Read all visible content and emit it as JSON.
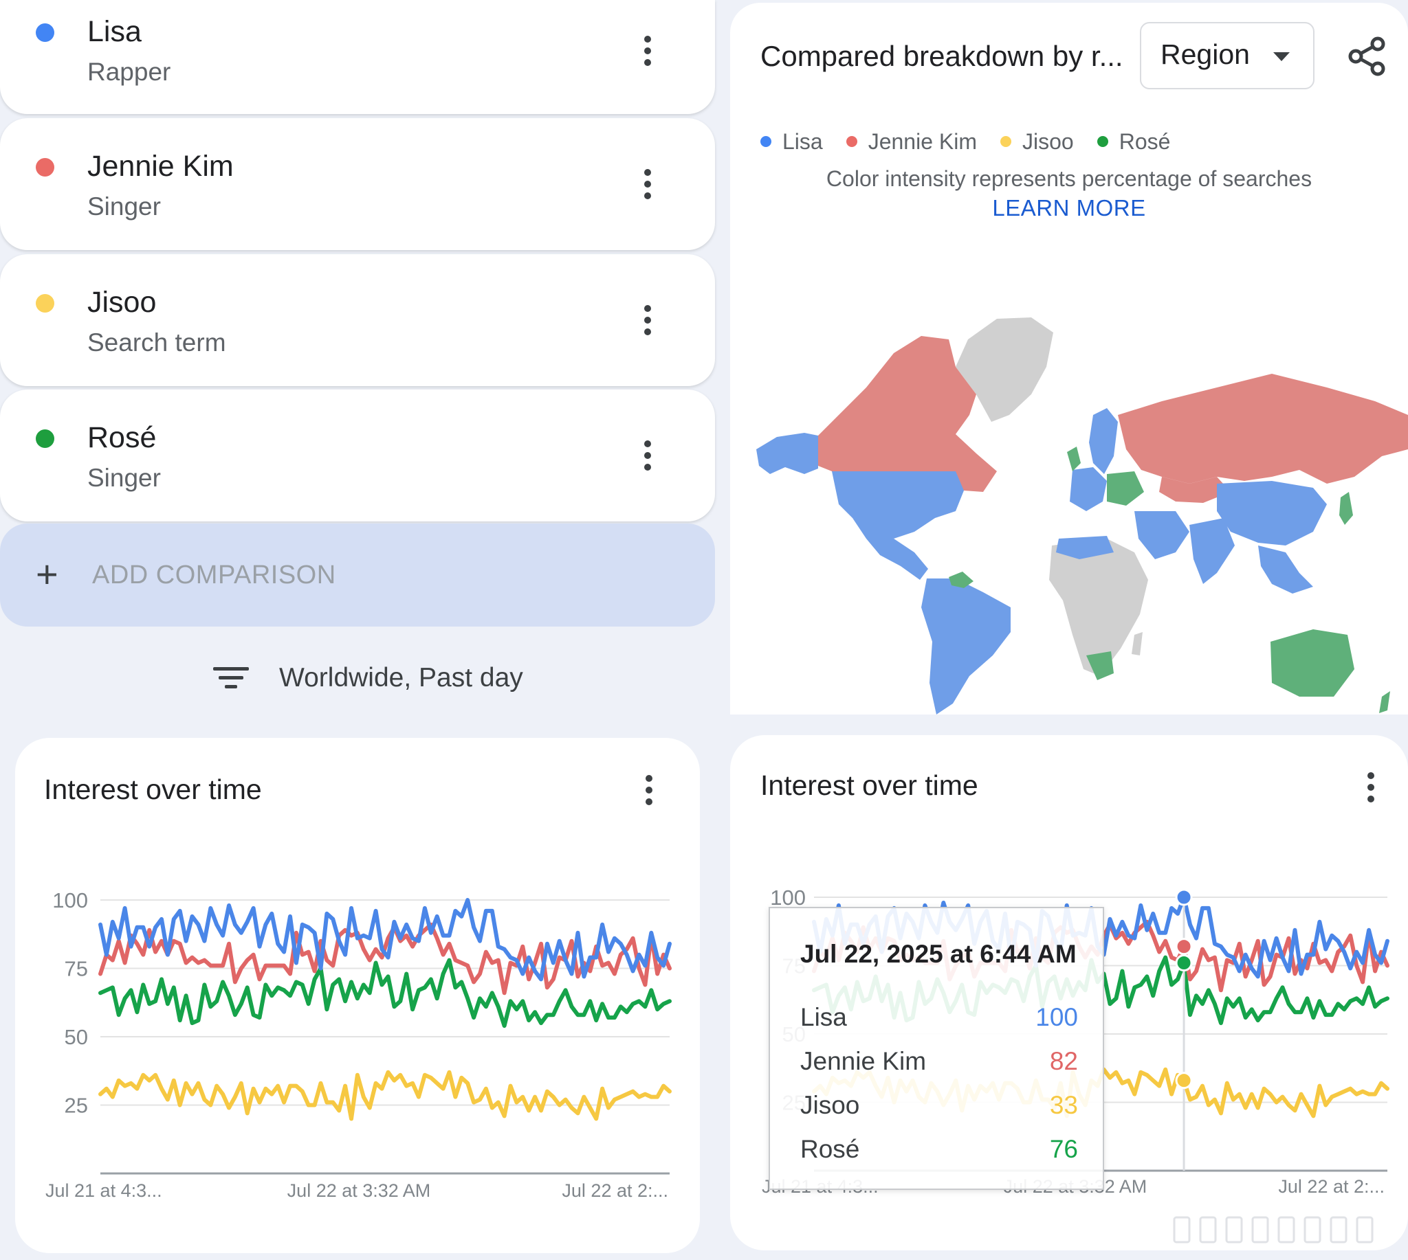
{
  "terms": [
    {
      "name": "Lisa",
      "subtitle": "Rapper",
      "color": "#4285f4"
    },
    {
      "name": "Jennie Kim",
      "subtitle": "Singer",
      "color": "#ea6b66"
    },
    {
      "name": "Jisoo",
      "subtitle": "Search term",
      "color": "#fbd25a"
    },
    {
      "name": "Rosé",
      "subtitle": "Singer",
      "color": "#1e9e3e"
    }
  ],
  "add_comparison": {
    "label": "ADD COMPARISON"
  },
  "filter": {
    "label": "Worldwide, Past day"
  },
  "map_card": {
    "title": "Compared breakdown by r...",
    "region_select": "Region",
    "legend": [
      "Lisa",
      "Jennie Kim",
      "Jisoo",
      "Rosé"
    ],
    "note": "Color intensity represents percentage of searches",
    "learn_more": "LEARN MORE",
    "colors": {
      "lisa": "#6f9ee8",
      "jennie": "#df8783",
      "rose": "#5fb07a",
      "none": "#d0d0d0"
    }
  },
  "interest_left": {
    "title": "Interest over time"
  },
  "interest_right": {
    "title": "Interest over time"
  },
  "tooltip": {
    "date": "Jul 22, 2025 at 6:44 AM",
    "rows": [
      {
        "name": "Lisa",
        "value": "100"
      },
      {
        "name": "Jennie Kim",
        "value": "82"
      },
      {
        "name": "Jisoo",
        "value": "33"
      },
      {
        "name": "Rosé",
        "value": "76"
      }
    ]
  },
  "chart_data": [
    {
      "type": "line",
      "title": "Interest over time",
      "ylim": [
        0,
        100
      ],
      "yticks": [
        "100",
        "75",
        "50",
        "25"
      ],
      "xticks": [
        "Jul 21 at 4:3...",
        "Jul 22 at 3:32 AM",
        "Jul 22 at 2:..."
      ],
      "grid": true,
      "series": [
        {
          "name": "Lisa",
          "color": "#4a86e8",
          "values": [
            91,
            80,
            92,
            86,
            97,
            83,
            90,
            90,
            83,
            90,
            93,
            80,
            93,
            96,
            85,
            94,
            91,
            85,
            97,
            91,
            87,
            98,
            91,
            88,
            92,
            97,
            83,
            91,
            95,
            84,
            81,
            94,
            77,
            91,
            90,
            88,
            75,
            95,
            93,
            85,
            80,
            97,
            86,
            87,
            86,
            96,
            82,
            79,
            92,
            86,
            91,
            86,
            85,
            97,
            88,
            94,
            87,
            87,
            96,
            94,
            100,
            90,
            85,
            96,
            96,
            83,
            82,
            79,
            78,
            73,
            79,
            74,
            71,
            84,
            77,
            85,
            78,
            73,
            88,
            72,
            79,
            79,
            91,
            81,
            86,
            84,
            80,
            74,
            80,
            76,
            88,
            79,
            76,
            84
          ]
        },
        {
          "name": "Jennie Kim",
          "color": "#e06666",
          "values": [
            73,
            80,
            78,
            85,
            77,
            87,
            84,
            80,
            89,
            81,
            85,
            80,
            85,
            84,
            77,
            79,
            77,
            78,
            76,
            76,
            76,
            84,
            70,
            75,
            78,
            80,
            71,
            76,
            76,
            76,
            76,
            73,
            88,
            80,
            81,
            74,
            85,
            78,
            76,
            87,
            89,
            87,
            88,
            82,
            78,
            82,
            79,
            86,
            90,
            85,
            87,
            83,
            87,
            89,
            91,
            86,
            80,
            84,
            78,
            77,
            76,
            70,
            73,
            81,
            77,
            78,
            66,
            77,
            76,
            83,
            71,
            77,
            84,
            68,
            71,
            79,
            78,
            85,
            72,
            77,
            74,
            83,
            76,
            77,
            73,
            80,
            82,
            86,
            75,
            69,
            87,
            73,
            80,
            75
          ]
        },
        {
          "name": "Jisoo",
          "color": "#f6c842",
          "values": [
            29,
            31,
            28,
            34,
            32,
            33,
            31,
            36,
            34,
            36,
            31,
            27,
            34,
            25,
            33,
            29,
            33,
            27,
            25,
            32,
            29,
            24,
            28,
            33,
            22,
            31,
            26,
            31,
            29,
            32,
            26,
            32,
            32,
            30,
            25,
            25,
            33,
            26,
            26,
            23,
            32,
            20,
            36,
            28,
            24,
            33,
            31,
            37,
            34,
            36,
            32,
            33,
            28,
            36,
            35,
            33,
            31,
            37,
            28,
            35,
            33,
            26,
            27,
            31,
            24,
            26,
            21,
            32,
            26,
            28,
            23,
            28,
            23,
            30,
            28,
            25,
            27,
            24,
            22,
            28,
            24,
            20,
            31,
            24,
            27,
            28,
            29,
            30,
            28,
            29,
            28,
            28,
            32,
            30
          ]
        },
        {
          "name": "Rosé",
          "color": "#16a34a",
          "values": [
            66,
            67,
            68,
            58,
            64,
            67,
            59,
            69,
            62,
            63,
            71,
            62,
            68,
            56,
            65,
            55,
            56,
            69,
            61,
            63,
            70,
            65,
            58,
            62,
            68,
            58,
            57,
            69,
            65,
            68,
            67,
            65,
            70,
            69,
            62,
            71,
            75,
            60,
            69,
            71,
            63,
            70,
            64,
            69,
            66,
            77,
            69,
            72,
            61,
            63,
            73,
            60,
            67,
            68,
            71,
            64,
            73,
            78,
            68,
            70,
            64,
            57,
            64,
            61,
            66,
            61,
            54,
            63,
            60,
            63,
            56,
            59,
            55,
            58,
            58,
            63,
            67,
            61,
            58,
            58,
            63,
            56,
            62,
            57,
            57,
            61,
            59,
            62,
            63,
            61,
            67,
            60,
            62,
            63
          ]
        }
      ]
    },
    {
      "type": "line",
      "title": "Interest over time",
      "ylim": [
        0,
        100
      ],
      "yticks": [
        "100",
        "75",
        "50",
        "25"
      ],
      "xticks": [
        "Jul 21 at 4:3...",
        "Jul 22 at 3:32 AM",
        "Jul 22 at 2:..."
      ],
      "grid": true,
      "highlight_index": 60,
      "series": [
        {
          "name": "Lisa",
          "color": "#4a86e8",
          "values": [
            91,
            80,
            92,
            86,
            97,
            83,
            90,
            90,
            83,
            90,
            93,
            80,
            93,
            96,
            85,
            94,
            91,
            85,
            97,
            91,
            87,
            98,
            91,
            88,
            92,
            97,
            83,
            91,
            95,
            84,
            81,
            94,
            77,
            91,
            90,
            88,
            75,
            95,
            93,
            85,
            80,
            97,
            86,
            87,
            86,
            96,
            82,
            79,
            92,
            86,
            91,
            86,
            85,
            97,
            88,
            94,
            87,
            87,
            96,
            94,
            100,
            90,
            85,
            96,
            96,
            83,
            82,
            79,
            78,
            73,
            79,
            74,
            71,
            84,
            77,
            85,
            78,
            73,
            88,
            72,
            79,
            79,
            91,
            81,
            86,
            84,
            80,
            74,
            80,
            76,
            88,
            79,
            76,
            84
          ]
        },
        {
          "name": "Jennie Kim",
          "color": "#e06666",
          "values": [
            73,
            80,
            78,
            85,
            77,
            87,
            84,
            80,
            89,
            81,
            85,
            80,
            85,
            84,
            77,
            79,
            77,
            78,
            76,
            76,
            76,
            84,
            70,
            75,
            78,
            80,
            71,
            76,
            76,
            76,
            76,
            73,
            88,
            80,
            81,
            74,
            85,
            78,
            76,
            87,
            89,
            87,
            88,
            82,
            78,
            82,
            79,
            86,
            90,
            85,
            87,
            83,
            87,
            89,
            91,
            86,
            80,
            84,
            78,
            77,
            82,
            70,
            73,
            81,
            77,
            78,
            66,
            77,
            76,
            83,
            71,
            77,
            84,
            68,
            71,
            79,
            78,
            85,
            72,
            77,
            74,
            83,
            76,
            77,
            73,
            80,
            82,
            86,
            75,
            69,
            87,
            73,
            80,
            75
          ]
        },
        {
          "name": "Jisoo",
          "color": "#f6c842",
          "values": [
            29,
            31,
            28,
            34,
            32,
            33,
            31,
            36,
            34,
            36,
            31,
            27,
            34,
            25,
            33,
            29,
            33,
            27,
            25,
            32,
            29,
            24,
            28,
            33,
            22,
            31,
            26,
            31,
            29,
            32,
            26,
            32,
            32,
            30,
            25,
            25,
            33,
            26,
            26,
            23,
            32,
            20,
            36,
            28,
            24,
            33,
            31,
            37,
            34,
            36,
            32,
            33,
            28,
            36,
            35,
            33,
            31,
            37,
            28,
            35,
            33,
            26,
            27,
            31,
            24,
            26,
            21,
            32,
            26,
            28,
            23,
            28,
            23,
            30,
            28,
            25,
            27,
            24,
            22,
            28,
            24,
            20,
            31,
            24,
            27,
            28,
            29,
            30,
            28,
            29,
            28,
            28,
            32,
            30
          ]
        },
        {
          "name": "Rosé",
          "color": "#16a34a",
          "values": [
            66,
            67,
            68,
            58,
            64,
            67,
            59,
            69,
            62,
            63,
            71,
            62,
            68,
            56,
            65,
            55,
            56,
            69,
            61,
            63,
            70,
            65,
            58,
            62,
            68,
            58,
            57,
            69,
            65,
            68,
            67,
            65,
            70,
            69,
            62,
            71,
            75,
            60,
            69,
            71,
            63,
            70,
            64,
            69,
            66,
            77,
            69,
            72,
            61,
            63,
            73,
            60,
            67,
            68,
            71,
            64,
            73,
            78,
            68,
            70,
            76,
            57,
            64,
            61,
            66,
            61,
            54,
            63,
            60,
            63,
            56,
            59,
            55,
            58,
            58,
            63,
            67,
            61,
            58,
            58,
            63,
            56,
            62,
            57,
            57,
            61,
            59,
            62,
            63,
            61,
            67,
            60,
            62,
            63
          ]
        }
      ]
    }
  ]
}
